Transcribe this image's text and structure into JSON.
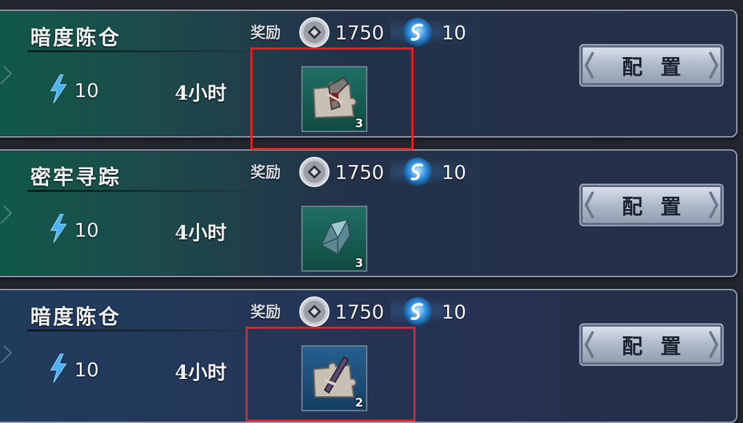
{
  "missions": [
    {
      "title": "暗度陈仓",
      "energy": "10",
      "time": "4小时",
      "reward_label": "奖励",
      "coin_reward": "1750",
      "orb_reward": "10",
      "item_count": "3",
      "item_icon": "puzzle-piece-icon",
      "config_label": "配置",
      "theme": "green"
    },
    {
      "title": "密牢寻踪",
      "energy": "10",
      "time": "4小时",
      "reward_label": "奖励",
      "coin_reward": "1750",
      "orb_reward": "10",
      "item_count": "3",
      "item_icon": "crystal-shard-icon",
      "config_label": "配置",
      "theme": "green"
    },
    {
      "title": "暗度陈仓",
      "energy": "10",
      "time": "4小时",
      "reward_label": "奖励",
      "coin_reward": "1750",
      "orb_reward": "10",
      "item_count": "2",
      "item_icon": "puzzle-piece-icon",
      "config_label": "配置",
      "theme": "blue"
    }
  ],
  "colors": {
    "highlight": "#e52222",
    "energy_bolt": "#4db3ff"
  }
}
